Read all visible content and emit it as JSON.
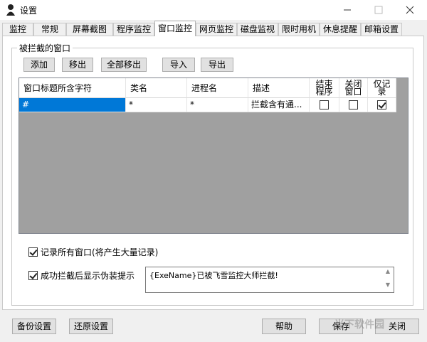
{
  "window": {
    "title": "设置"
  },
  "tabs": [
    {
      "label": "监控"
    },
    {
      "label": "常规"
    },
    {
      "label": "屏幕截图"
    },
    {
      "label": "程序监控"
    },
    {
      "label": "窗口监控"
    },
    {
      "label": "网页监控"
    },
    {
      "label": "磁盘监视"
    },
    {
      "label": "限时用机"
    },
    {
      "label": "休息提醒"
    },
    {
      "label": "邮箱设置"
    }
  ],
  "group": {
    "title": "被拦截的窗口"
  },
  "toolbar": {
    "add": "添加",
    "remove": "移出",
    "remove_all": "全部移出",
    "import": "导入",
    "export": "导出"
  },
  "grid": {
    "headers": {
      "title": "窗口标题所含字符",
      "class": "类名",
      "process": "进程名",
      "desc": "描述",
      "end": "结束程序",
      "close": "关闭窗口",
      "log": "仅记录"
    },
    "row": {
      "title": "#",
      "class": "*",
      "process": "*",
      "desc": "拦截含有通...",
      "end": false,
      "close": false,
      "log": true
    }
  },
  "options": {
    "record_all": {
      "label": "记录所有窗口(将产生大量记录)",
      "checked": true
    },
    "show_tip": {
      "label": "成功拦截后显示伪装提示",
      "checked": true
    },
    "tip_text": "{ExeName}已被飞雪监控大师拦截!"
  },
  "bottom": {
    "backup": "备份设置",
    "restore": "还原设置",
    "help": "帮助",
    "save": "保存",
    "close": "关闭"
  },
  "watermark": "当下软件园"
}
